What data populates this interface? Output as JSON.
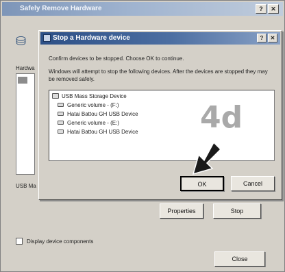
{
  "outer": {
    "title": "Safely Remove Hardware",
    "minimize_glyph": "?",
    "close_glyph": "✕",
    "hw_label": "Hardwa",
    "usb_label": "USB Ma",
    "properties_label": "Properties",
    "stop_label": "Stop",
    "display_components_label": "Display device components",
    "close_label": "Close"
  },
  "dialog": {
    "title": "Stop a Hardware device",
    "help_glyph": "?",
    "close_glyph": "✕",
    "text1": "Confirm devices to be stopped. Choose OK to continue.",
    "text2": "Windows will attempt to stop the following devices. After the devices are stopped they may be removed safely.",
    "devices": [
      {
        "label": "USB Mass Storage Device",
        "level": "root"
      },
      {
        "label": "Generic volume - (F:)",
        "level": "child"
      },
      {
        "label": "Hatai Battou GH USB Device",
        "level": "child"
      },
      {
        "label": "Generic volume - (E:)",
        "level": "child"
      },
      {
        "label": "Hatai Battou GH USB Device",
        "level": "child"
      }
    ],
    "ok_label": "OK",
    "cancel_label": "Cancel"
  },
  "annotation": {
    "step_label": "4d",
    "arrow_color": "#1a1a1a"
  }
}
